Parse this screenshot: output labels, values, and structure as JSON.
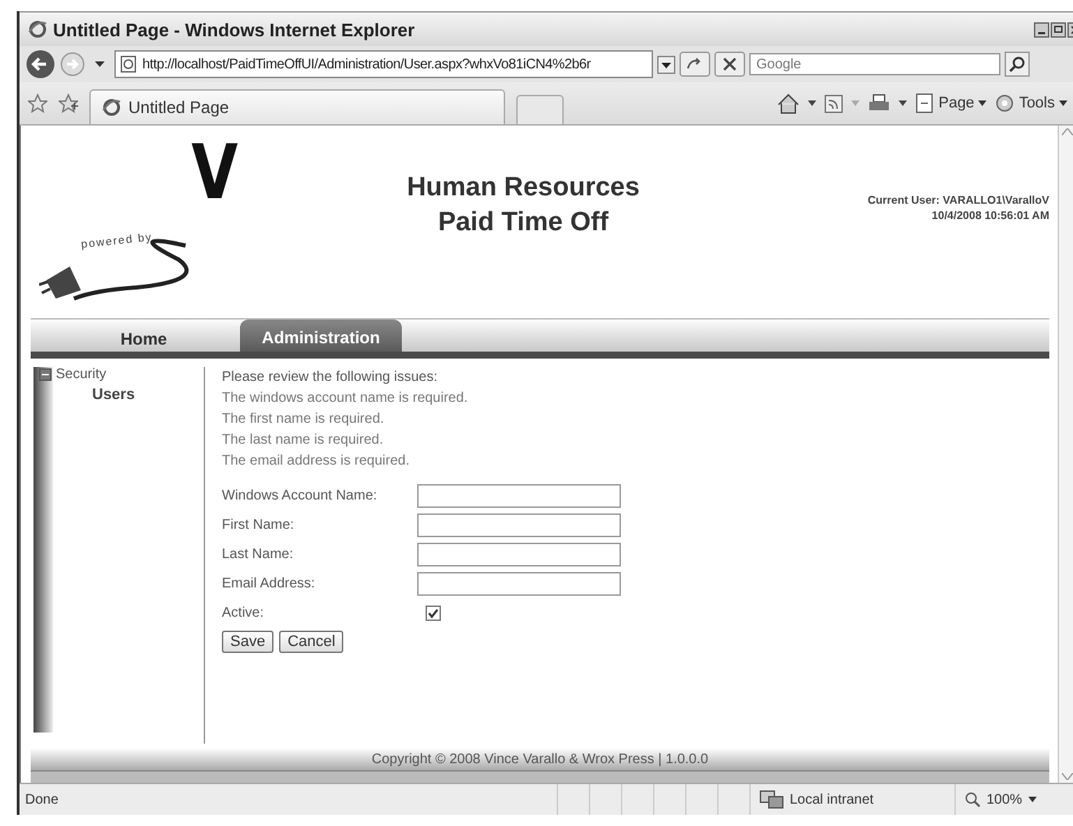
{
  "window": {
    "title": "Untitled Page - Windows Internet Explorer"
  },
  "address_bar": {
    "url": "http://localhost/PaidTimeOffUI/Administration/User.aspx?whxVo81iCN4%2b6r"
  },
  "search": {
    "placeholder": "Google"
  },
  "browser_tabs": [
    {
      "label": "Untitled Page",
      "selected": true
    }
  ],
  "command_bar": [
    {
      "label": "Page"
    },
    {
      "label": "Tools"
    }
  ],
  "page": {
    "logo_letter": "V",
    "logo_text": "powered by",
    "title_lines": [
      "Human Resources",
      "Paid Time Off"
    ],
    "current_user": "Current User: VARALLO1\\VaralloV",
    "timestamp": "10/4/2008 10:56:01 AM",
    "menu_tabs": [
      {
        "label": "Home",
        "selected": false
      },
      {
        "label": "Administration",
        "selected": true
      }
    ],
    "tree": [
      {
        "label": "Security",
        "expanded": true,
        "children": [
          {
            "label": "Users"
          }
        ]
      }
    ],
    "messages": [
      "Please review the following issues:",
      "The windows account name is required.",
      "The first name is required.",
      "The last name is required.",
      "The email address is required."
    ],
    "fields": [
      {
        "kind": "text",
        "label": "Windows Account Name:"
      },
      {
        "kind": "text",
        "label": "First Name:"
      },
      {
        "kind": "text",
        "label": "Last Name:"
      },
      {
        "kind": "text",
        "label": "Email Address:"
      },
      {
        "kind": "checkbox",
        "label": "Active:",
        "checked": true
      }
    ],
    "buttons": [
      "Save",
      "Cancel"
    ],
    "footer": "Copyright © 2008 Vince Varallo & Wrox Press | 1.0.0.0"
  },
  "status_bar": {
    "text": "Done",
    "zone": "Local intranet",
    "zoom": "100%"
  }
}
